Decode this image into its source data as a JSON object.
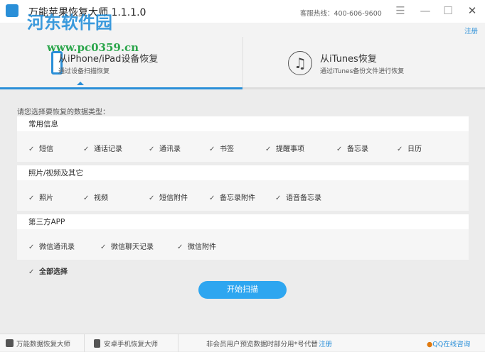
{
  "window": {
    "title": "万能苹果恢复大师 1.1.1.0",
    "hotline": "客服热线：400-606-9600",
    "register": "注册"
  },
  "tabs": [
    {
      "title": "从iPhone/iPad设备恢复",
      "subtitle": "通过设备扫描恢复",
      "active": true
    },
    {
      "title": "从iTunes恢复",
      "subtitle": "通过iTunes备份文件进行恢复",
      "active": false
    }
  ],
  "prompt": "请您选择要恢复的数据类型：",
  "sections": [
    {
      "title": "常用信息",
      "items": [
        "短信",
        "通话记录",
        "通讯录",
        "书签",
        "提醒事项",
        "备忘录",
        "日历"
      ]
    },
    {
      "title": "照片/视频及其它",
      "items": [
        "照片",
        "视频",
        "短信附件",
        "备忘录附件",
        "语音备忘录"
      ]
    },
    {
      "title": "第三方APP",
      "items": [
        "微信通讯录",
        "微信聊天记录",
        "微信附件"
      ]
    }
  ],
  "select_all": "全部选择",
  "start_button": "开始扫描",
  "footer": {
    "link1": "万能数据恢复大师",
    "link2": "安卓手机恢复大师",
    "notice": "非会员用户预览数据时部分用*号代替",
    "register": "注册",
    "qq": "QQ在线咨询"
  },
  "watermark": {
    "name": "河东软件园",
    "url": "www.pc0359.cn"
  }
}
